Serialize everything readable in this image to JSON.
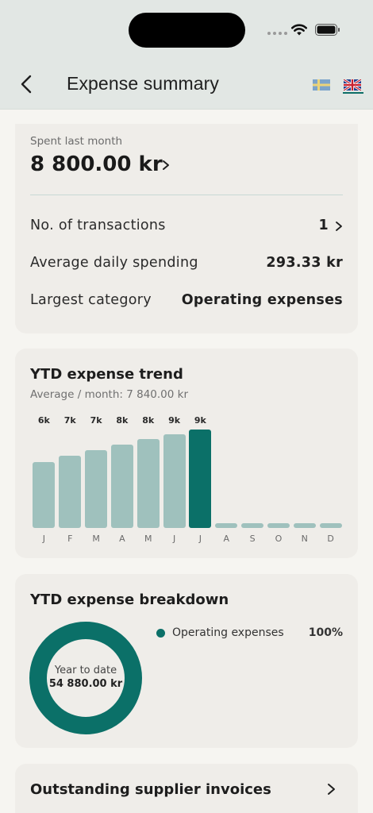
{
  "status_bar": {
    "icons": [
      "signal-dots-icon",
      "wifi-icon",
      "battery-icon"
    ]
  },
  "nav": {
    "title": "Expense summary",
    "back_icon": "chevron-left-icon",
    "languages": [
      "swedish-flag-icon",
      "uk-flag-icon"
    ],
    "selected_language": "uk-flag-icon"
  },
  "summary": {
    "spent_label": "Spent last month",
    "spent_value": "8 800.00 kr",
    "rows": [
      {
        "label": "No. of transactions",
        "value": "1"
      },
      {
        "label": "Average daily spending",
        "value": "293.33 kr"
      },
      {
        "label": "Largest category",
        "value": "Operating expenses"
      }
    ]
  },
  "trend": {
    "title": "YTD expense trend",
    "subtitle": "Average / month: 7 840.00 kr"
  },
  "chart_data": {
    "type": "bar",
    "categories": [
      "J",
      "F",
      "M",
      "A",
      "M",
      "J",
      "J",
      "A",
      "S",
      "O",
      "N",
      "D"
    ],
    "values": [
      6000,
      6600,
      7100,
      7600,
      8100,
      8600,
      9000,
      0,
      0,
      0,
      0,
      0
    ],
    "data_labels": [
      "6k",
      "7k",
      "7k",
      "8k",
      "8k",
      "9k",
      "9k",
      "",
      "",
      "",
      "",
      ""
    ],
    "highlight_index": 6,
    "colors": {
      "default": "#9fc1bd",
      "highlight": "#0b7068"
    },
    "title": "YTD expense trend"
  },
  "breakdown": {
    "title": "YTD expense breakdown",
    "center_label": "Year to date",
    "center_value": "54 880.00 kr",
    "legend": [
      {
        "label": "Operating expenses",
        "percent": "100%",
        "color": "#0b7068"
      }
    ]
  },
  "invoices": {
    "title": "Outstanding supplier invoices"
  },
  "colors": {
    "accent": "#0b7068",
    "header_bg": "#e2e7e4",
    "card_bg": "#efede9",
    "page_bg": "#f6f5f1"
  }
}
